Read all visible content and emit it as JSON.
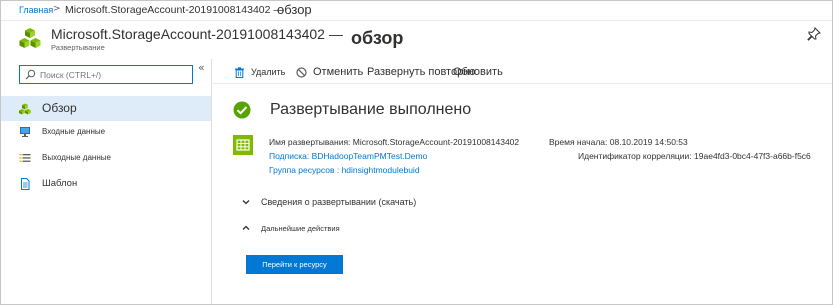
{
  "breadcrumb": {
    "home": "Главная",
    "separator": ">",
    "current": "Microsoft.StorageAccount-20191008143402 —",
    "overview": "обзор"
  },
  "header": {
    "title": "Microsoft.StorageAccount-20191008143402  —",
    "subtitle": "Развертывание",
    "overview": "обзор",
    "icon": "resource-group-cubes-icon",
    "pin_icon": "pin-icon"
  },
  "sidebar": {
    "search_placeholder": "Поиск (CTRL+/)",
    "collapse": "«",
    "items": [
      {
        "label": "Обзор",
        "icon": "overview-cubes-icon",
        "active": true
      },
      {
        "label": "Входные данные",
        "icon": "monitor-icon",
        "active": false
      },
      {
        "label": "Выходные данные",
        "icon": "list-icon",
        "active": false
      },
      {
        "label": "Шаблон",
        "icon": "document-icon",
        "active": false
      }
    ]
  },
  "toolbar": {
    "delete": "Удалить",
    "cancel": "Отменить",
    "redeploy": "Развернуть повторно",
    "refresh": "Обновить"
  },
  "status": {
    "title": "Развертывание выполнено"
  },
  "deployment": {
    "name_label": "Имя развертывания:",
    "name_value": "Microsoft.StorageAccount-20191008143402",
    "start_label": "Время начала:",
    "start_value": "08.10.2019 14:50:53",
    "subscription_label": "Подписка:",
    "subscription_value": "BDHadoopTeamPMTest.Demo",
    "correlation_label": "Идентификатор корреляции:",
    "correlation_value": "19ae4fd3-0bc4-47f3-a66b-f5c6",
    "rg_label": "Группа ресурсов :",
    "rg_value": "hdinsightmodulebuid"
  },
  "sections": {
    "details": "Сведения о развертывании (скачать)",
    "next_steps": "Дальнейшие действия"
  },
  "go_button": "Перейти к ресурсу",
  "colors": {
    "accent": "#0078d4",
    "success": "#57a300",
    "active_bg": "#deecf9"
  }
}
